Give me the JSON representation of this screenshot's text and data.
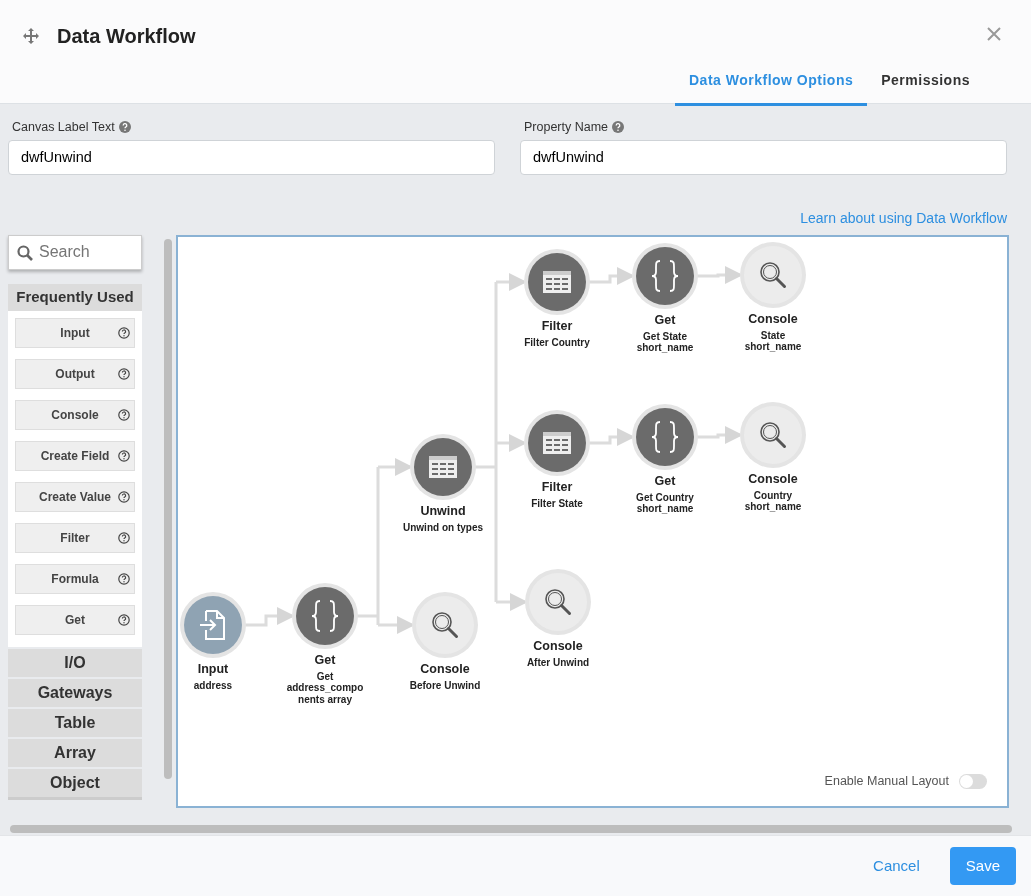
{
  "dialog": {
    "title": "Data Workflow",
    "tabs": [
      {
        "label": "Data Workflow Options",
        "selected": true
      },
      {
        "label": "Permissions",
        "selected": false
      }
    ]
  },
  "fields": [
    {
      "label": "Canvas Label Text",
      "value": "dwfUnwind"
    },
    {
      "label": "Property Name",
      "value": "dwfUnwind"
    }
  ],
  "help_link": "Learn about using Data Workflow",
  "palette": {
    "search": {
      "placeholder": "Search"
    },
    "sections": [
      {
        "title": "Frequently Used",
        "expanded": true,
        "items": [
          "Input",
          "Output",
          "Console",
          "Create Field",
          "Create Value",
          "Filter",
          "Formula",
          "Get"
        ]
      },
      {
        "title": "I/O",
        "expanded": false
      },
      {
        "title": "Gateways",
        "expanded": false
      },
      {
        "title": "Table",
        "expanded": false
      },
      {
        "title": "Array",
        "expanded": false
      },
      {
        "title": "Object",
        "expanded": false
      }
    ]
  },
  "canvas": {
    "nodes": [
      {
        "kind": "table",
        "title": "Filter",
        "subtitle": "Filter Country"
      },
      {
        "kind": "get",
        "title": "Get",
        "subtitle": "Get State\nshort_name"
      },
      {
        "kind": "console",
        "title": "Console",
        "subtitle": "State\nshort_name"
      },
      {
        "kind": "table",
        "title": "Filter",
        "subtitle": "Filter State"
      },
      {
        "kind": "get",
        "title": "Get",
        "subtitle": "Get Country\nshort_name"
      },
      {
        "kind": "console",
        "title": "Console",
        "subtitle": "Country\nshort_name"
      },
      {
        "kind": "table",
        "title": "Unwind",
        "subtitle": "Unwind on types"
      },
      {
        "kind": "console",
        "title": "Console",
        "subtitle": "After Unwind"
      },
      {
        "kind": "input",
        "title": "Input",
        "subtitle": "address"
      },
      {
        "kind": "get",
        "title": "Get",
        "subtitle": "Get\naddress_compo\nnents array"
      },
      {
        "kind": "console",
        "title": "Console",
        "subtitle": "Before Unwind"
      }
    ],
    "manual_layout": {
      "label": "Enable Manual Layout",
      "on": false
    }
  },
  "footer": {
    "buttons": [
      {
        "label": "Cancel",
        "kind": "link"
      },
      {
        "label": "Save",
        "kind": "primary"
      }
    ]
  }
}
